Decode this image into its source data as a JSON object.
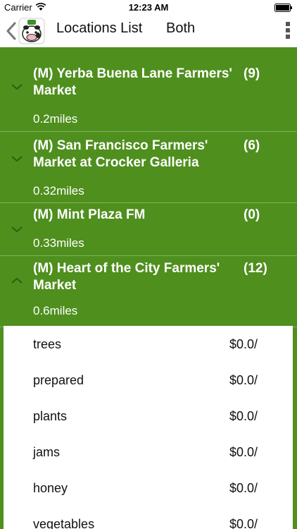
{
  "status_bar": {
    "carrier": "Carrier",
    "time": "12:23 AM"
  },
  "nav": {
    "title": "Locations List",
    "filter": "Both"
  },
  "locations": [
    {
      "name": "(M) Yerba Buena Lane Farmers' Market",
      "count": "(9)",
      "distance": "0.2miles",
      "expanded": false
    },
    {
      "name": "(M) San Francisco Farmers' Market at Crocker Galleria",
      "count": "(6)",
      "distance": "0.32miles",
      "expanded": false
    },
    {
      "name": "(M) Mint Plaza FM",
      "count": "(0)",
      "distance": "0.33miles",
      "expanded": false
    },
    {
      "name": "(M) Heart of the City Farmers' Market",
      "count": "(12)",
      "distance": "0.6miles",
      "expanded": true
    }
  ],
  "items": [
    {
      "name": "trees",
      "price": "$0.0/"
    },
    {
      "name": "prepared",
      "price": "$0.0/"
    },
    {
      "name": "plants",
      "price": "$0.0/"
    },
    {
      "name": "jams",
      "price": "$0.0/"
    },
    {
      "name": "honey",
      "price": "$0.0/"
    },
    {
      "name": "vegetables",
      "price": "$0.0/"
    }
  ],
  "colors": {
    "accent_green": "#4f8f1e",
    "divider": "#7fb25a"
  },
  "icons": {
    "back": "chevron-left-icon",
    "more": "vertical-dots-icon",
    "collapsed": "chevron-down-icon",
    "expanded": "chevron-up-icon"
  }
}
